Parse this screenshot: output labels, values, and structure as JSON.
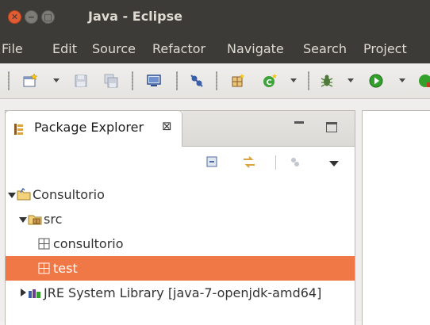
{
  "window": {
    "title": "Java - Eclipse"
  },
  "menu": [
    "File",
    "Edit",
    "Source",
    "Refactor",
    "Navigate",
    "Search",
    "Project"
  ],
  "panel": {
    "tab_label": "Package Explorer",
    "close_glyph": "⊠"
  },
  "tree": [
    {
      "label": "Consultorio",
      "icon": "project-folder-icon",
      "expanded": true,
      "depth": 0
    },
    {
      "label": "src",
      "icon": "source-folder-icon",
      "expanded": true,
      "depth": 1
    },
    {
      "label": "consultorio",
      "icon": "package-icon",
      "depth": 2
    },
    {
      "label": "test",
      "icon": "package-icon",
      "depth": 2,
      "selected": true
    },
    {
      "label": "JRE System Library [java-7-openjdk-amd64]",
      "icon": "library-icon",
      "expanded": false,
      "depth": 1
    }
  ],
  "colors": {
    "titlebar": "#3c3b37",
    "close_button": "#e25c33",
    "selection": "#f07746"
  }
}
